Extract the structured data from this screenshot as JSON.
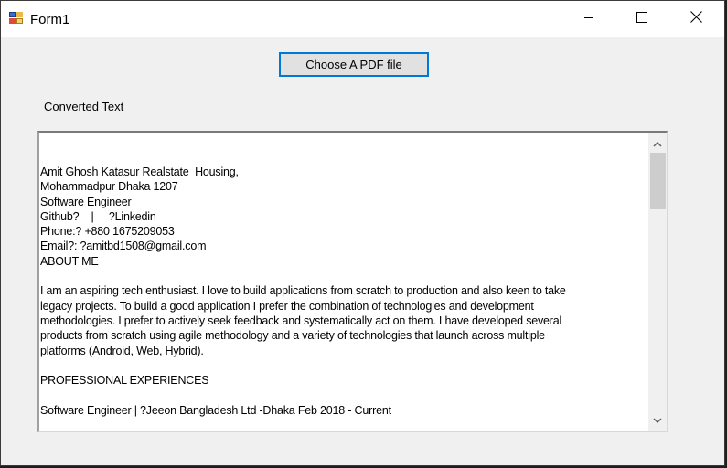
{
  "window": {
    "title": "Form1",
    "icon": "winforms-app-icon",
    "controls": {
      "minimize": "minimize-icon",
      "maximize": "maximize-icon",
      "close": "close-icon"
    }
  },
  "main": {
    "choose_pdf_button": "Choose A PDF file",
    "converted_label": "Converted Text",
    "text_lines": [
      "Amit Ghosh Katasur Realstate  Housing,",
      "Mohammadpur Dhaka 1207",
      "Software Engineer",
      "Github?    |     ?Linkedin",
      "Phone:? +880 1675209053",
      "Email?: ?amitbd1508@gmail.com",
      "ABOUT ME",
      "",
      "I am an aspiring tech enthusiast. I love to build applications from scratch to production and also keen to take",
      "legacy projects. To build a good application I prefer the combination of technologies and development",
      "methodologies. I prefer to actively seek feedback and systematically act on them. I have developed several",
      "products from scratch using agile methodology and a variety of technologies that launch across multiple",
      "platforms (Android, Web, Hybrid).",
      "",
      "PROFESSIONAL EXPERIENCES",
      "",
      "Software Engineer | ?Jeeon Bangladesh Ltd -Dhaka Feb 2018 - Current"
    ],
    "scrollbar": {
      "up": "chevron-up-icon",
      "down": "chevron-down-icon"
    }
  }
}
